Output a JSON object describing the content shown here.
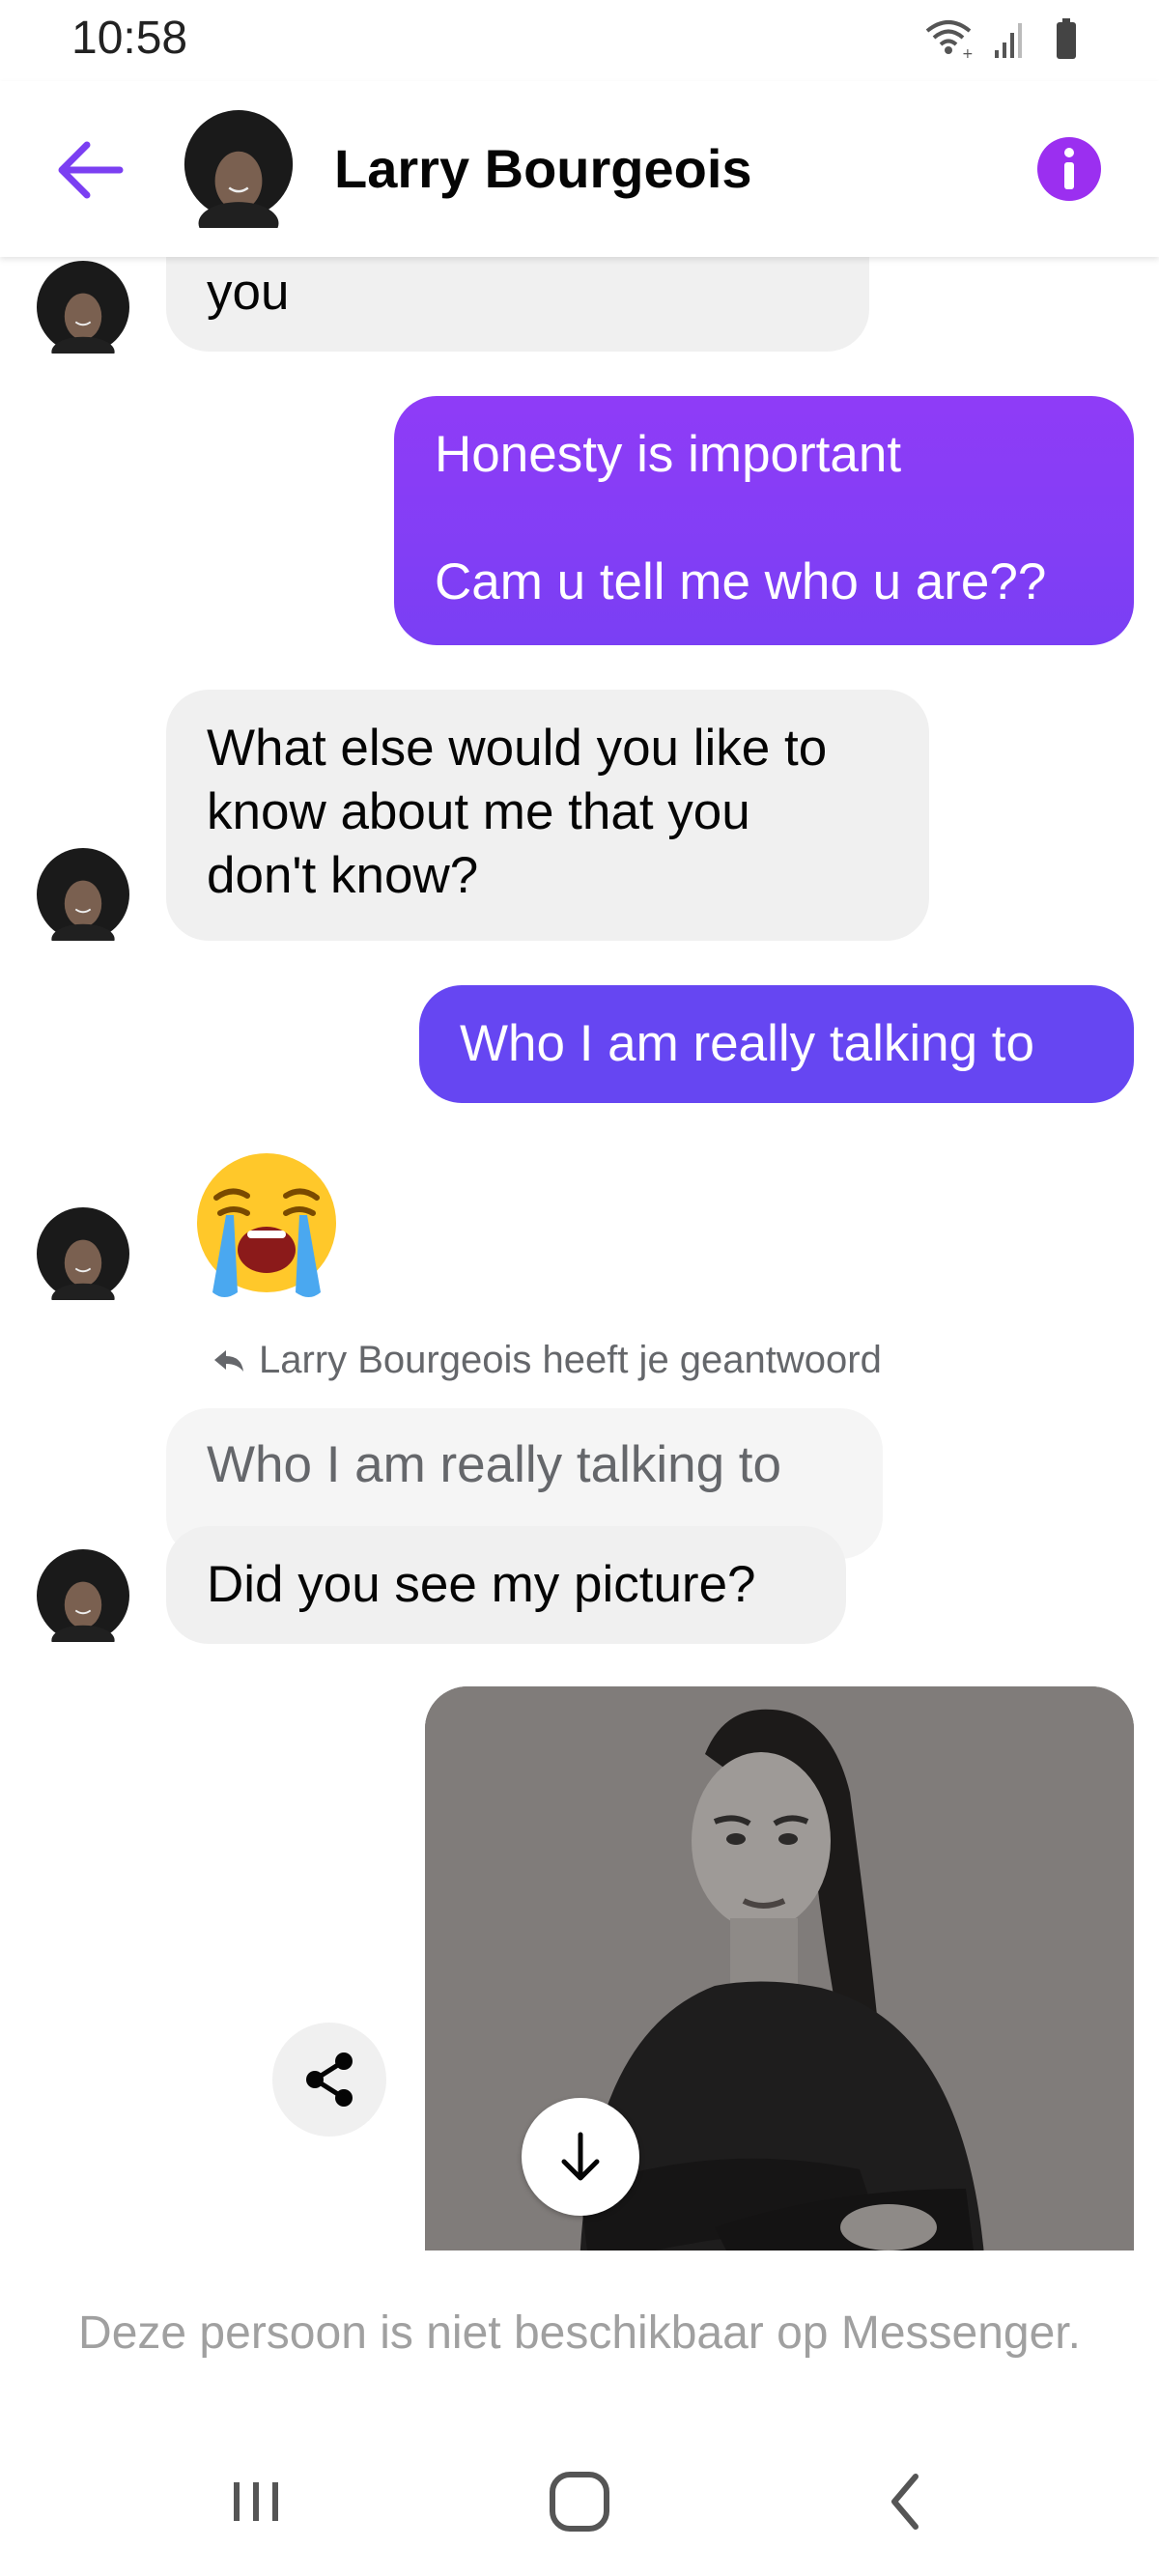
{
  "status_bar": {
    "time": "10:58"
  },
  "header": {
    "contact_name": "Larry Bourgeois"
  },
  "messages": [
    {
      "dir": "in",
      "text": "you"
    },
    {
      "dir": "out",
      "text": "Honesty is important\n\nCam u tell me who u are??"
    },
    {
      "dir": "in",
      "text": "What else would you like to\nknow about me that you\ndon't know?"
    },
    {
      "dir": "out",
      "text": "Who I am really talking to"
    },
    {
      "dir": "in",
      "text": "😭"
    },
    {
      "dir": "in",
      "reply_label": "Larry Bourgeois  heeft je geantwoord",
      "quoted": "Who I am really talking to",
      "text": "Did you see my picture?"
    }
  ],
  "footer": {
    "unavailable_text": "Deze persoon is niet beschikbaar op Messenger."
  },
  "colors": {
    "accent": "#7b3ff2",
    "bubble_out_top": "#8f3cf7",
    "bubble_out_bottom": "#6346f2",
    "bubble_in": "#f0f0f0"
  }
}
